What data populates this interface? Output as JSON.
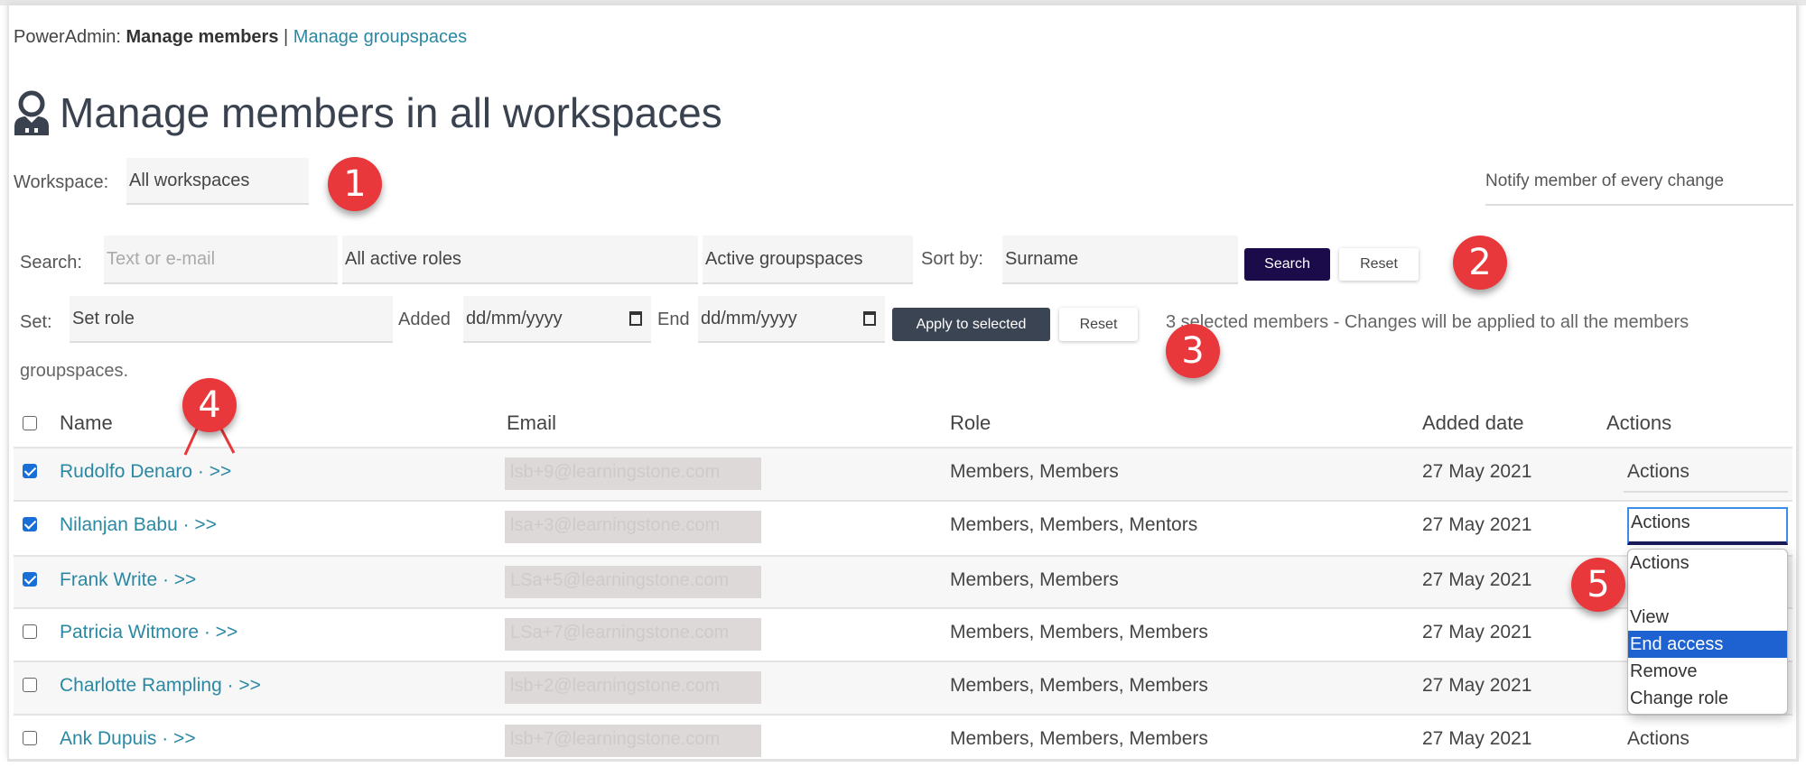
{
  "breadcrumb": {
    "prefix": "PowerAdmin: ",
    "current": "Manage members",
    "separator": " | ",
    "link": "Manage groupspaces"
  },
  "page": {
    "title": "Manage members in all workspaces",
    "icon": "admin-user-icon"
  },
  "workspace": {
    "label": "Workspace:",
    "value": "All workspaces"
  },
  "notify": {
    "label": "Notify member of every change"
  },
  "search": {
    "label": "Search:",
    "placeholder": "Text or e-mail",
    "roles": "All active roles",
    "groupspaces": "Active groupspaces",
    "sort_label": "Sort by:",
    "sort_value": "Surname",
    "search_button": "Search",
    "reset_button": "Reset"
  },
  "set": {
    "label": "Set:",
    "role": "Set role",
    "added_label": "Added",
    "added_date": "dd/mm/yyyy",
    "end_label": "End",
    "end_date": "dd/mm/yyyy",
    "apply_button": "Apply to selected",
    "reset_button": "Reset",
    "message": "3 selected members - Changes will be applied to all the members",
    "message_cont": "groupspaces."
  },
  "callouts": [
    "1",
    "2",
    "3",
    "4",
    "5"
  ],
  "table": {
    "headers": {
      "name": "Name",
      "email": "Email",
      "role": "Role",
      "added": "Added date",
      "actions": "Actions"
    },
    "rows": [
      {
        "name": "Rudolfo Denaro · >>",
        "email": "lsb+9@learningstone.com",
        "role": "Members, Members",
        "added": "27 May 2021",
        "actions": "Actions",
        "checked": true
      },
      {
        "name": "Nilanjan Babu · >>",
        "email": "lsa+3@learningstone.com",
        "role": "Members, Members, Mentors",
        "added": "27 May 2021",
        "actions": "Actions",
        "checked": true
      },
      {
        "name": "Frank Write · >>",
        "email": "LSa+5@learningstone.com",
        "role": "Members, Members",
        "added": "27 May 2021",
        "actions": "",
        "checked": true
      },
      {
        "name": "Patricia Witmore · >>",
        "email": "LSa+7@learningstone.com",
        "role": "Members, Members, Members",
        "added": "27 May 2021",
        "actions": "",
        "checked": false
      },
      {
        "name": "Charlotte Rampling · >>",
        "email": "lsb+2@learningstone.com",
        "role": "Members, Members, Members",
        "added": "27 May 2021",
        "actions": "",
        "checked": false
      },
      {
        "name": "Ank Dupuis · >>",
        "email": "lsb+7@learningstone.com",
        "role": "Members, Members, Members",
        "added": "27 May 2021",
        "actions": "Actions",
        "checked": false
      }
    ]
  },
  "actions_dropdown": {
    "options": [
      "Actions",
      "",
      "View",
      "End access",
      "Remove",
      "Change role"
    ],
    "highlighted": "End access"
  },
  "colors": {
    "link": "#2b88a3",
    "search_button": "#1c0b4b",
    "apply_button": "#3b4452",
    "callout": "#e8383b",
    "highlight": "#1d62d0"
  }
}
